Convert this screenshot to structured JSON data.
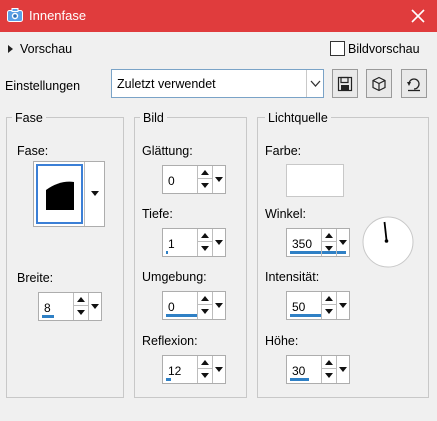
{
  "window": {
    "title": "Innenfase"
  },
  "preview": {
    "label": "Vorschau"
  },
  "bildvorschau": {
    "label": "Bildvorschau",
    "checked": false
  },
  "settings": {
    "label": "Einstellungen",
    "preset_value": "Zuletzt verwendet"
  },
  "toolbar": {
    "icons": [
      "save-icon",
      "cube-icon",
      "reset-icon"
    ]
  },
  "groups": {
    "fase": {
      "title": "Fase",
      "shape_label": "Fase:",
      "width_label": "Breite:",
      "width_value": "8"
    },
    "bild": {
      "title": "Bild",
      "smoothing_label": "Glättung:",
      "smoothing_value": "0",
      "depth_label": "Tiefe:",
      "depth_value": "1",
      "ambience_label": "Umgebung:",
      "ambience_value": "0",
      "reflection_label": "Reflexion:",
      "reflection_value": "12"
    },
    "light": {
      "title": "Lichtquelle",
      "color_label": "Farbe:",
      "color_value": "#ffffff",
      "angle_label": "Winkel:",
      "angle_value": "350",
      "intensity_label": "Intensität:",
      "intensity_value": "50",
      "height_label": "Höhe:",
      "height_value": "30"
    }
  },
  "colors": {
    "titlebar": "#e03c3d",
    "accent": "#2f80c5"
  }
}
